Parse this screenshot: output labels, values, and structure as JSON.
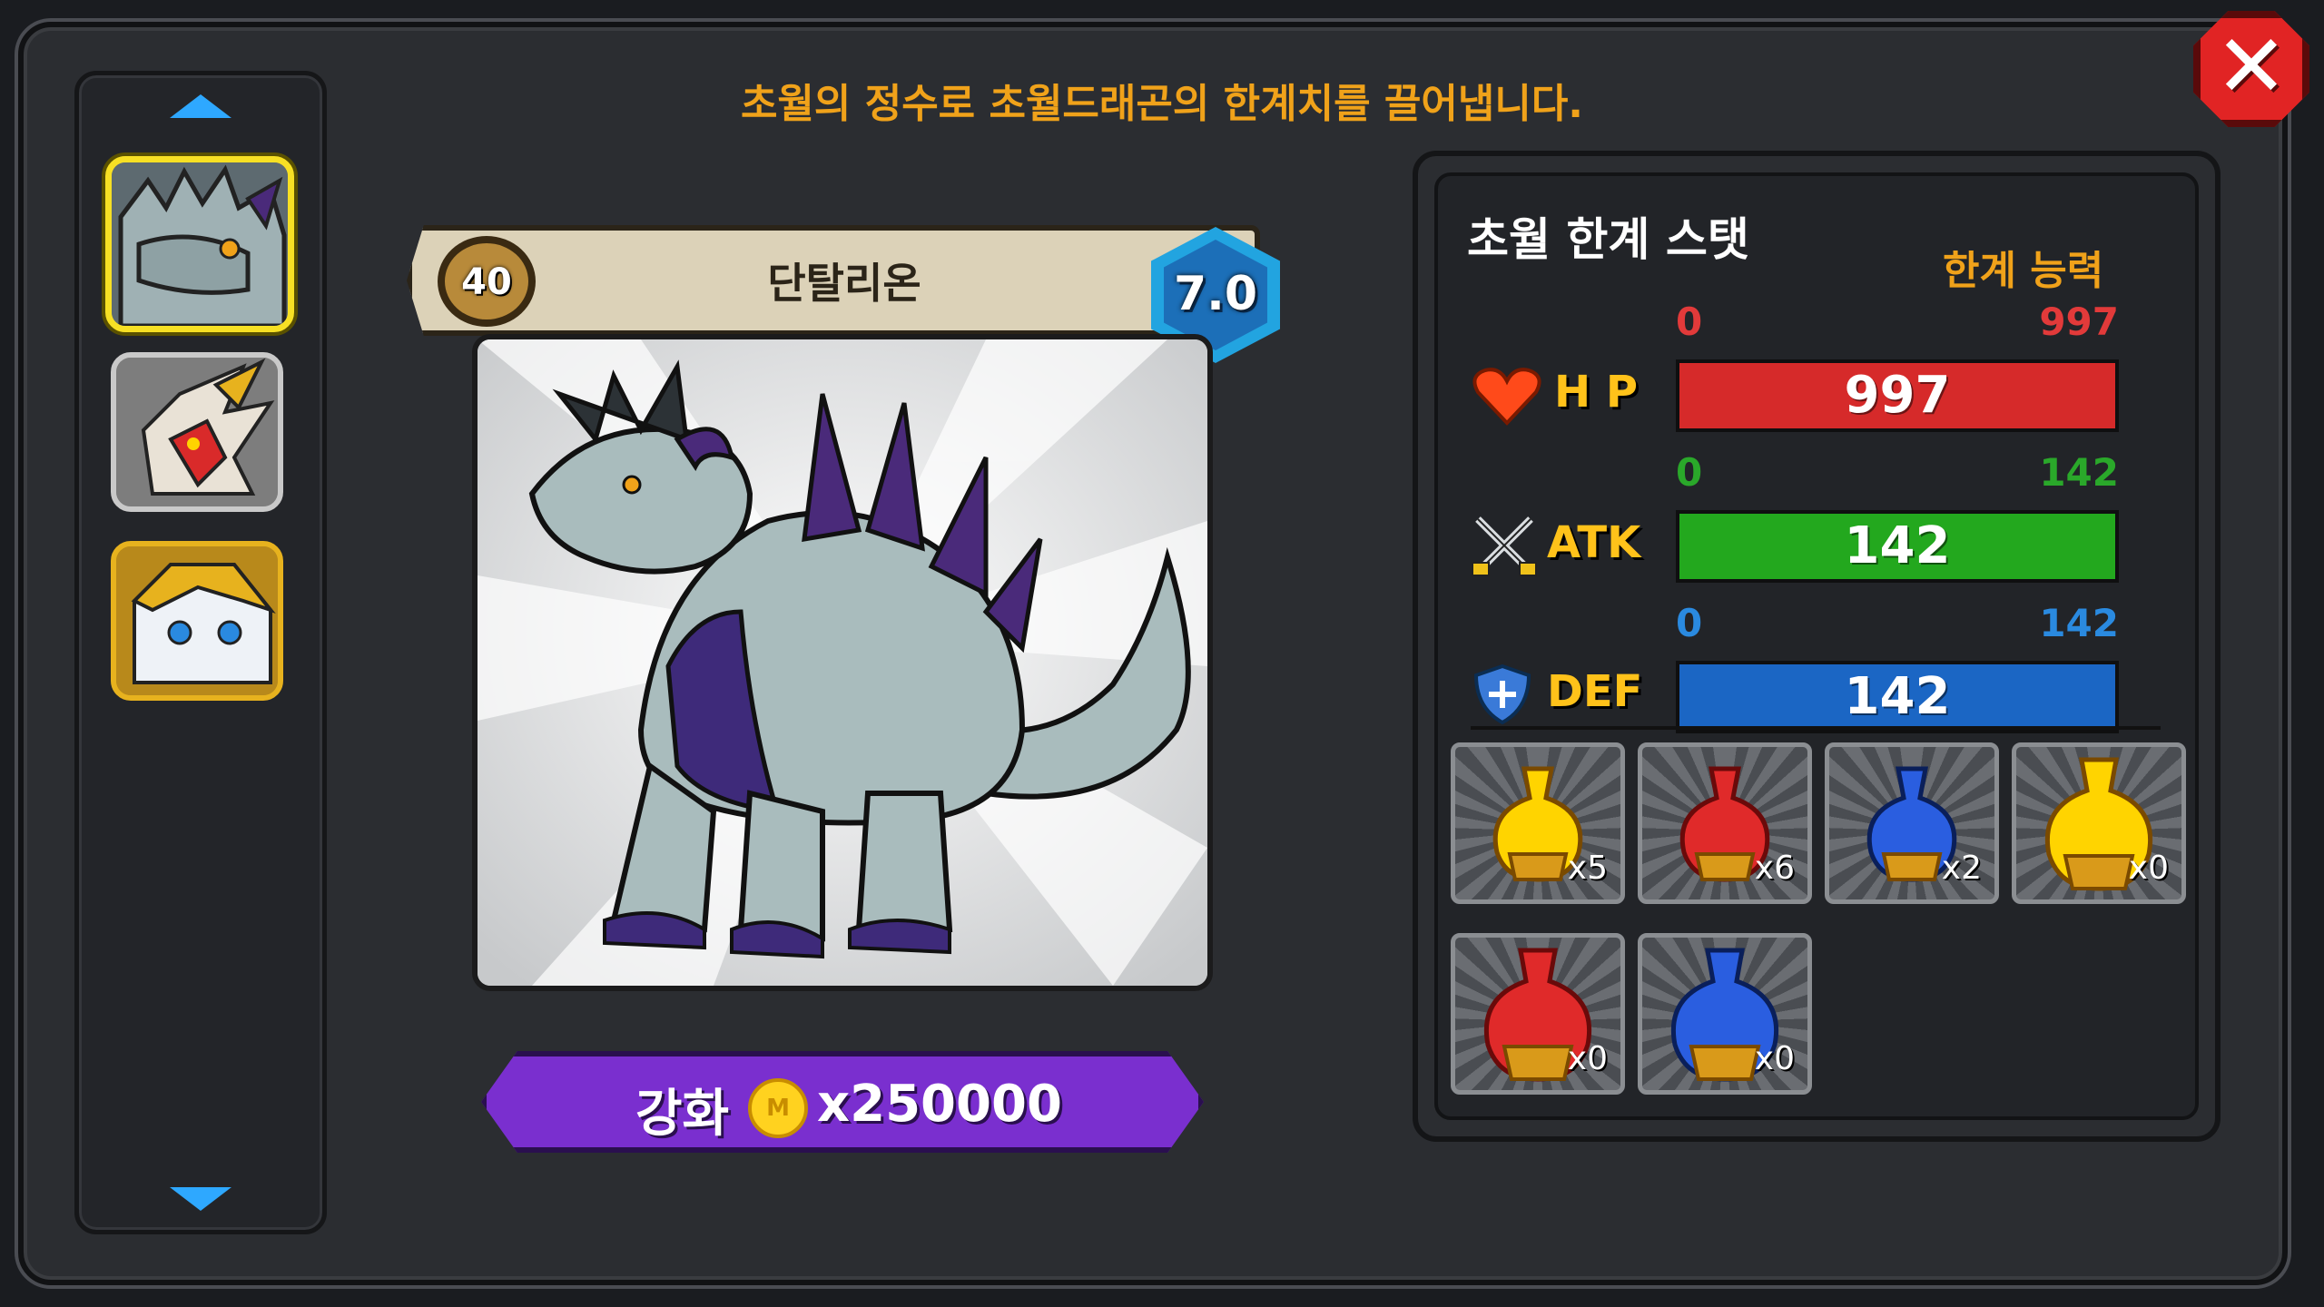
{
  "instruction": "초월의 정수로 초월드래곤의 한계치를 끌어냅니다.",
  "creature": {
    "level": "40",
    "name": "단탈리온",
    "grade": "7.0"
  },
  "enhance": {
    "label": "강화",
    "coin_symbol": "M",
    "cost": "x250000"
  },
  "stats": {
    "title": "초월 한계 스탯",
    "limit_label": "한계 능력",
    "rows": [
      {
        "label": "H P",
        "min": "0",
        "max": "997",
        "value": "997",
        "fill": 1.0,
        "color": "#d62a2a"
      },
      {
        "label": "ATK",
        "min": "0",
        "max": "142",
        "value": "142",
        "fill": 1.0,
        "color": "#23a81e"
      },
      {
        "label": "DEF",
        "min": "0",
        "max": "142",
        "value": "142",
        "fill": 1.0,
        "color": "#1b66c4"
      }
    ]
  },
  "potions": [
    {
      "count": "x5",
      "color": "#ffd400"
    },
    {
      "count": "x6",
      "color": "#e02a2a"
    },
    {
      "count": "x2",
      "color": "#2a5ee0"
    },
    {
      "count": "x0",
      "color": "#ffd400"
    },
    {
      "count": "x0",
      "color": "#e02a2a"
    },
    {
      "count": "x0",
      "color": "#2a5ee0"
    }
  ],
  "sidebar": {
    "thumbs": [
      "dark-dragon-portrait",
      "red-dragon-portrait",
      "white-gold-dragon-portrait"
    ]
  },
  "colors": {
    "accent_orange": "#f0a21a",
    "selected_border": "#f7e024"
  }
}
